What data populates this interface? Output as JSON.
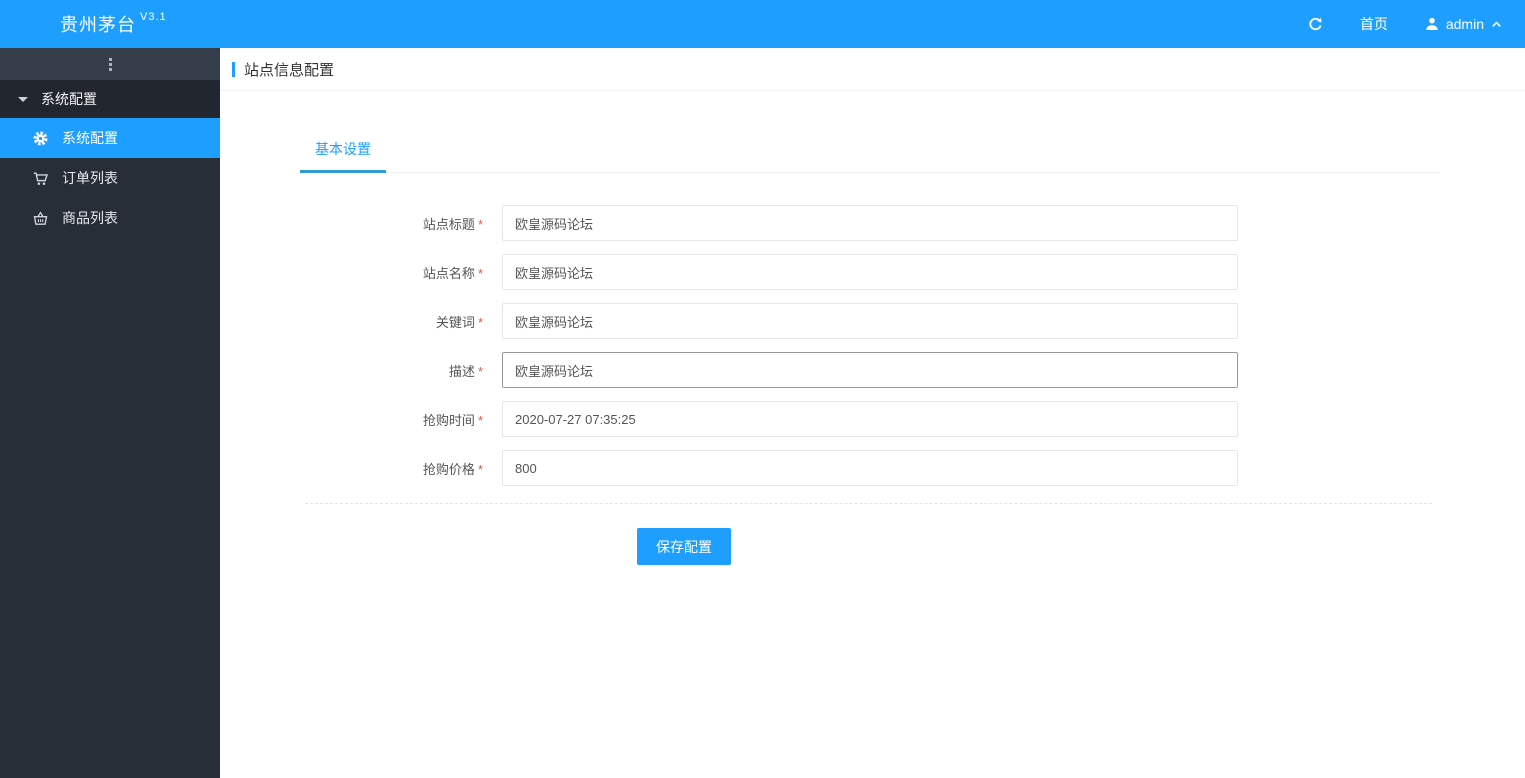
{
  "topbar": {
    "logo": "贵州茅台",
    "version": "V3.1",
    "home_label": "首页",
    "username": "admin"
  },
  "sidebar": {
    "group_label": "系统配置",
    "items": [
      {
        "label": "系统配置",
        "icon": "gear-icon",
        "active": true
      },
      {
        "label": "订单列表",
        "icon": "cart-icon",
        "active": false
      },
      {
        "label": "商品列表",
        "icon": "basket-icon",
        "active": false
      }
    ]
  },
  "page": {
    "title": "站点信息配置",
    "tab_label": "基本设置",
    "save_label": "保存配置"
  },
  "form": {
    "required_mark": "*",
    "fields": [
      {
        "label": "站点标题",
        "value": "欧皇源码论坛",
        "required": true
      },
      {
        "label": "站点名称",
        "value": "欧皇源码论坛",
        "required": true
      },
      {
        "label": "关键词",
        "value": "欧皇源码论坛",
        "required": true
      },
      {
        "label": "描述",
        "value": "欧皇源码论坛",
        "required": true,
        "focused": true
      },
      {
        "label": "抢购时间",
        "value": "2020-07-27 07:35:25",
        "required": true
      },
      {
        "label": "抢购价格",
        "value": "800",
        "required": true
      }
    ]
  },
  "colors": {
    "accent": "#1e9fff",
    "sidebar_bg": "#272e38",
    "sidebar_group_bg": "#22262e",
    "sidebar_strip_bg": "#353d49",
    "required_mark": "#e2574c"
  }
}
